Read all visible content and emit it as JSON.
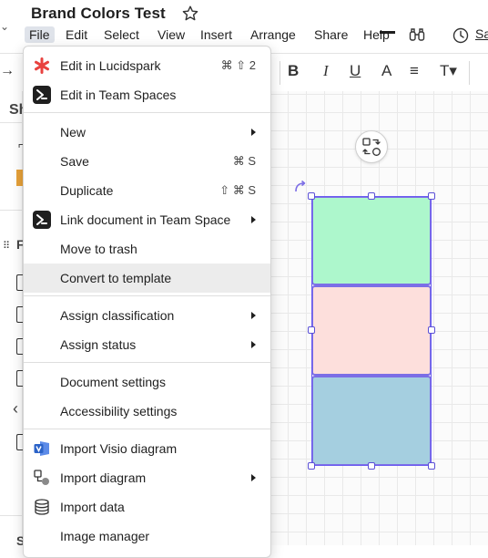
{
  "document": {
    "title": "Brand Colors Test"
  },
  "menubar": {
    "items": [
      "File",
      "Edit",
      "Select",
      "View",
      "Insert",
      "Arrange",
      "Share",
      "Help"
    ],
    "active": "File",
    "share_label_cut": "Sa"
  },
  "toolbar": {
    "bold": "B",
    "italic": "I",
    "underline": "U",
    "font_color": "A",
    "align": "≡",
    "text_options": "T▾"
  },
  "left_panel": {
    "header_cut": "Sh",
    "section_cut": "F",
    "footer_cut": "S"
  },
  "canvas": {
    "shapes": [
      {
        "name": "green",
        "fill": "#adf7cc"
      },
      {
        "name": "pink",
        "fill": "#fddfdc"
      },
      {
        "name": "blue",
        "fill": "#a5cfe0"
      }
    ],
    "selection_color": "#6b5df0"
  },
  "file_menu": {
    "items": [
      {
        "label": "Edit in Lucidspark",
        "shortcut": "⌘ ⇧ 2",
        "icon": "lucidspark-icon"
      },
      {
        "label": "Edit in Team Spaces",
        "icon": "team-spaces-icon"
      },
      {
        "label": "New",
        "submenu": true
      },
      {
        "label": "Save",
        "shortcut": "⌘ S"
      },
      {
        "label": "Duplicate",
        "shortcut": "⇧ ⌘ S"
      },
      {
        "label": "Link document in Team Space",
        "submenu": true,
        "icon": "team-spaces-icon"
      },
      {
        "label": "Move to trash"
      },
      {
        "label": "Convert to template",
        "hovered": true
      },
      {
        "label": "Assign classification",
        "submenu": true
      },
      {
        "label": "Assign status",
        "submenu": true
      },
      {
        "label": "Document settings"
      },
      {
        "label": "Accessibility settings"
      },
      {
        "label": "Import Visio diagram",
        "icon": "visio-icon"
      },
      {
        "label": "Import diagram",
        "submenu": true,
        "icon": "import-diagram-icon"
      },
      {
        "label": "Import data",
        "icon": "database-icon"
      },
      {
        "label": "Image manager"
      }
    ]
  },
  "colors": {
    "accent": "#6b5df0",
    "menu_hover": "#ececec",
    "menubar_active": "#dfe3ea",
    "lucidspark_red": "#e8423f",
    "visio_blue": "#2b63c8"
  }
}
